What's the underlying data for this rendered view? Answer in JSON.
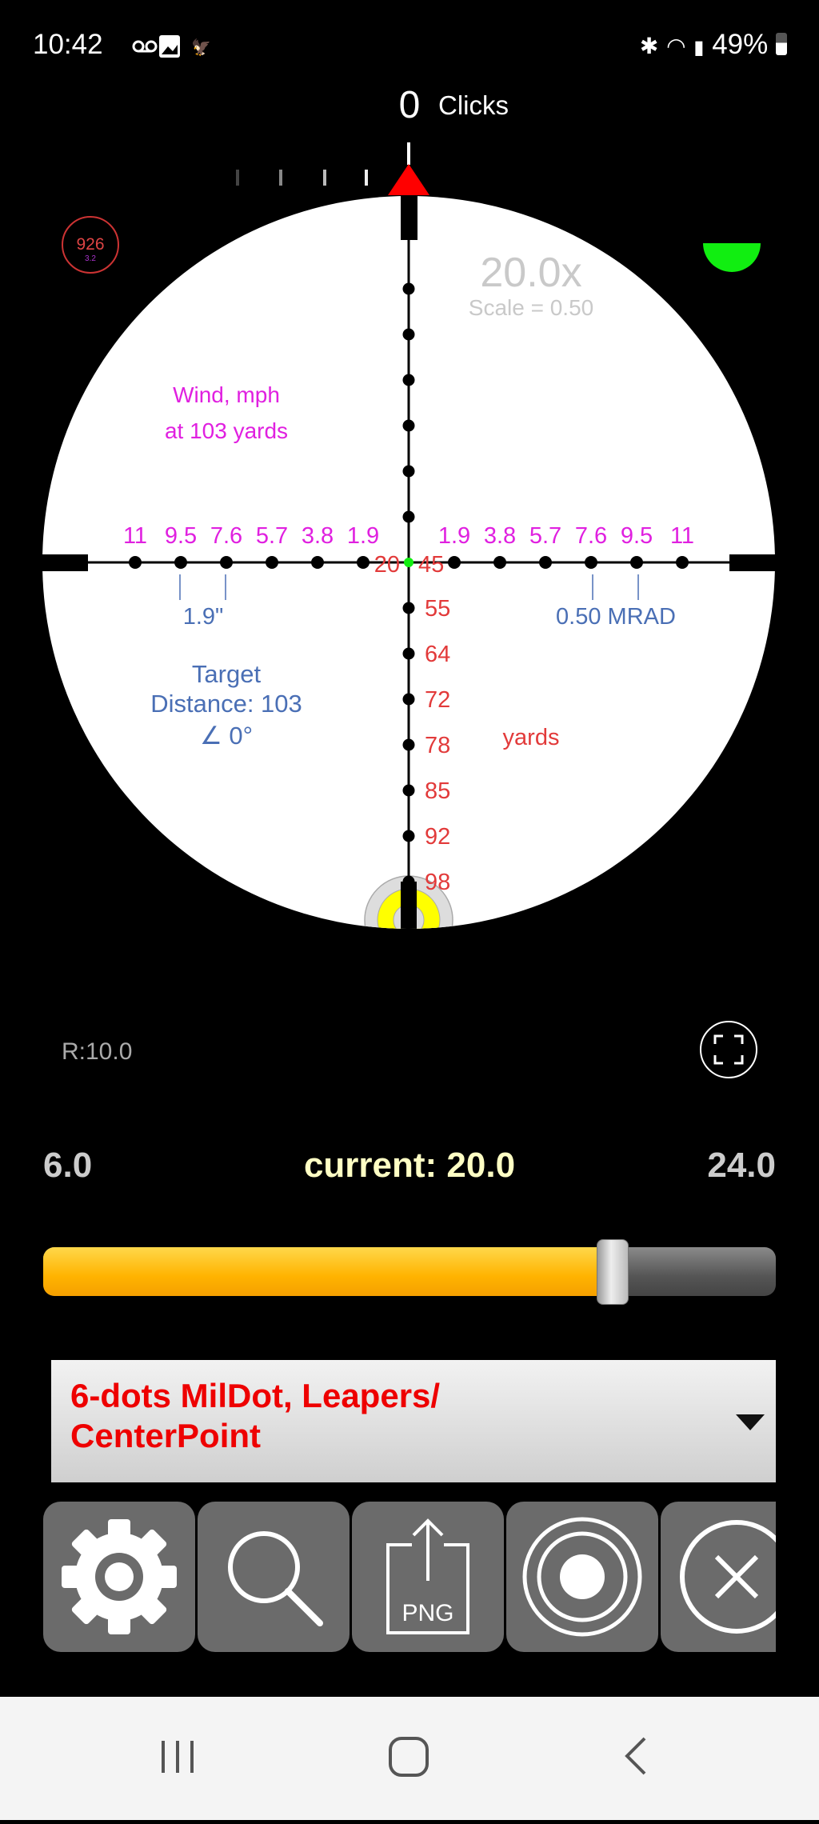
{
  "status_bar": {
    "time": "10:42",
    "battery": "49%",
    "icons": [
      "voicemail-icon",
      "gallery-icon",
      "ravens-icon",
      "bluetooth-icon",
      "wifi-icon",
      "signal-icon",
      "battery-icon"
    ]
  },
  "clicks": {
    "value": "0",
    "label": "Clicks"
  },
  "range_badge": {
    "value": "926",
    "sub": "3.2"
  },
  "magnification": {
    "value": "20.0x",
    "scale": "Scale = 0.50"
  },
  "wind": {
    "line1": "Wind, mph",
    "line2": "at 103 yards"
  },
  "wind_labels_left": [
    "11",
    "9.5",
    "7.6",
    "5.7",
    "3.8",
    "1.9"
  ],
  "wind_labels_right": [
    "1.9",
    "3.8",
    "5.7",
    "7.6",
    "9.5",
    "11"
  ],
  "center_labels": {
    "left": "20",
    "right": "45"
  },
  "range_labels": [
    "55",
    "64",
    "72",
    "78",
    "85",
    "92",
    "98"
  ],
  "range_unit": "yards",
  "inch_label": "1.9\"",
  "mrad_label": "0.50 MRAD",
  "target": {
    "line1": "Target",
    "line2": "Distance: 103",
    "line3": "∠ 0°"
  },
  "reticle_r": "R:10.0",
  "zoom": {
    "min": "6.0",
    "max": "24.0",
    "current": "current: 20.0",
    "min_value": 6,
    "max_value": 24,
    "current_value": 20
  },
  "reticle_select": {
    "selected": "6-dots MilDot, Leapers/ CenterPoint"
  },
  "toolbar": [
    "settings-gear-icon",
    "magnifier-icon",
    "export-png-icon",
    "target-icon",
    "close-icon"
  ],
  "toolbar_png_label": "PNG",
  "colors": {
    "wind": "#e020e0",
    "range": "#e23a3a",
    "info": "#4a6fb5",
    "slider_fill": "#ffb300",
    "level": "#11ee11",
    "triangle": "#ff0000"
  }
}
